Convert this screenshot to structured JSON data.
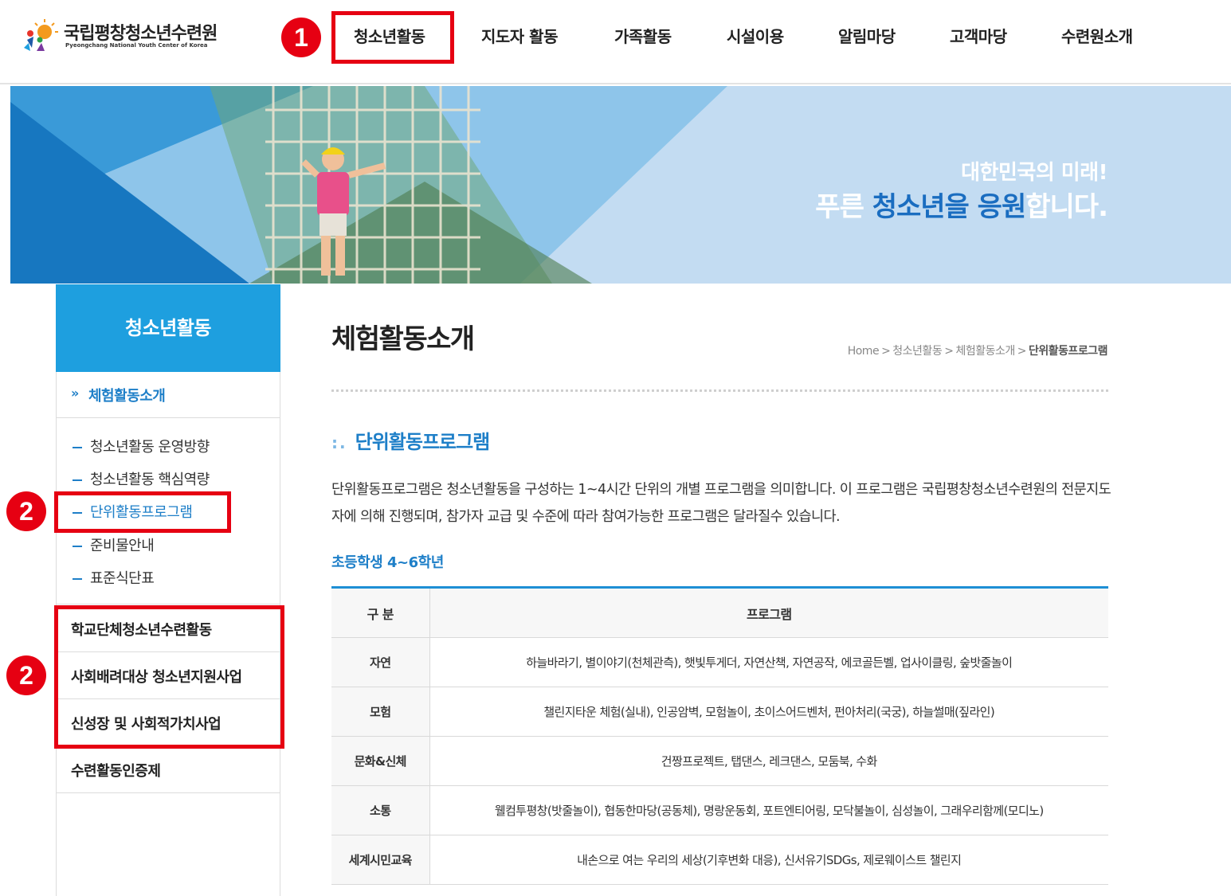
{
  "logo": {
    "name": "국립평창청소년수련원",
    "subtitle": "Pyeongchang National Youth Center of Korea"
  },
  "gnb": [
    {
      "label": "청소년활동"
    },
    {
      "label": "지도자 활동"
    },
    {
      "label": "가족활동"
    },
    {
      "label": "시설이용"
    },
    {
      "label": "알림마당"
    },
    {
      "label": "고객마당"
    },
    {
      "label": "수련원소개"
    }
  ],
  "annotations": {
    "badge1": "1",
    "badge2": "2",
    "badge3": "2",
    "color": "#e60012"
  },
  "banner": {
    "line1": "대한민국의 미래!",
    "line2_a": "푸른 ",
    "line2_b": "청소년을 응원",
    "line2_c": "합니다."
  },
  "sidebar": {
    "title": "청소년활동",
    "active": "체험활동소개",
    "sub_items": [
      {
        "label": "청소년활동 운영방향"
      },
      {
        "label": "청소년활동 핵심역량"
      },
      {
        "label": "단위활동프로그램"
      },
      {
        "label": "준비물안내"
      },
      {
        "label": "표준식단표"
      }
    ],
    "items": [
      {
        "label": "학교단체청소년수련활동"
      },
      {
        "label": "사회배려대상 청소년지원사업"
      },
      {
        "label": "신성장 및 사회적가치사업"
      },
      {
        "label": "수련활동인증제"
      }
    ]
  },
  "content": {
    "title": "체험활동소개",
    "breadcrumb": {
      "home": "Home",
      "b1": "청소년활동",
      "b2": "체험활동소개",
      "current": "단위활동프로그램"
    },
    "section_title": "단위활동프로그램",
    "description": "단위활동프로그램은 청소년활동을 구성하는 1~4시간 단위의 개별 프로그램을 의미합니다. 이 프로그램은 국립평창청소년수련원의 전문지도자에 의해 진행되며, 참가자 교급 및 수준에 따라 참여가능한 프로그램은 달라질수 있습니다.",
    "grade": "초등학생 4~6학년",
    "table": {
      "headers": [
        "구 분",
        "프로그램"
      ],
      "rows": [
        [
          "자연",
          "하늘바라기, 별이야기(천체관측), 햇빛투게더, 자연산책, 자연공작, 에코골든벨, 업사이클링, 숲밧줄놀이"
        ],
        [
          "모험",
          "챌린지타운 체험(실내), 인공암벽, 모험놀이, 초이스어드벤처, 펀아처리(국궁), 하늘썰매(짚라인)"
        ],
        [
          "문화&신체",
          "건짱프로젝트, 탭댄스, 레크댄스, 모둠북, 수화"
        ],
        [
          "소통",
          "웰컴투평창(밧줄놀이), 협동한마당(공동체), 명랑운동회, 포트엔티어링, 모닥불놀이, 심성놀이, 그래우리함께(모디노)"
        ],
        [
          "세계시민교육",
          "내손으로 여는 우리의 세상(기후변화 대응), 신서유기SDGs, 제로웨이스트 챌린지"
        ]
      ]
    }
  }
}
